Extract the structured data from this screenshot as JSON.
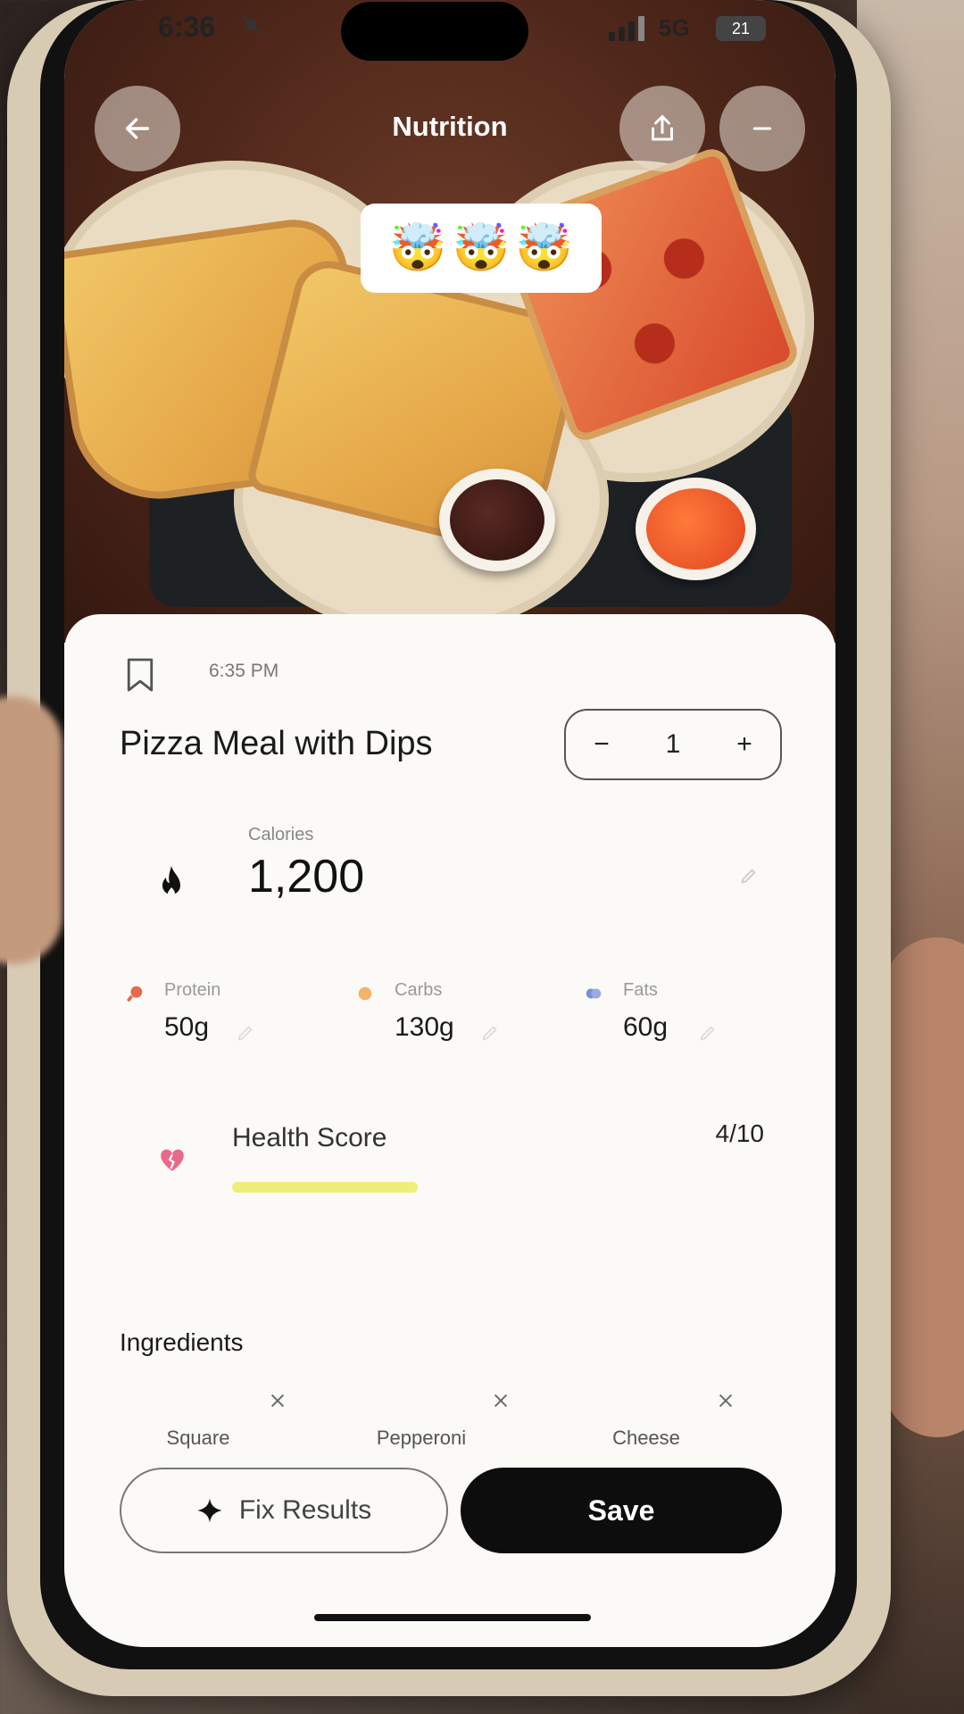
{
  "status_bar": {
    "time": "6:36",
    "network": "5G",
    "battery": "21"
  },
  "header": {
    "title": "Nutrition",
    "emoji": [
      "🤯",
      "🤯",
      "🤯"
    ]
  },
  "meal": {
    "time": "6:35 PM",
    "title": "Pizza Meal with Dips",
    "quantity": "1",
    "minus": "−",
    "plus": "+"
  },
  "calories": {
    "label": "Calories",
    "value": "1,200"
  },
  "macros": [
    {
      "label": "Protein",
      "value": "50g",
      "color": "#e8684c"
    },
    {
      "label": "Carbs",
      "value": "130g",
      "color": "#f2b46a"
    },
    {
      "label": "Fats",
      "value": "60g",
      "color": "#7a8fd6"
    }
  ],
  "health_score": {
    "label": "Health Score",
    "value": "4/10",
    "fraction": 0.4,
    "bar_color": "#f0ee7a"
  },
  "ingredients": {
    "title": "Ingredients",
    "items": [
      "Square",
      "Pepperoni",
      "Cheese"
    ]
  },
  "actions": {
    "fix_label": "Fix Results",
    "save_label": "Save"
  },
  "icons": {
    "back": "arrow-left-icon",
    "share": "share-icon",
    "more": "minus-icon",
    "bookmark": "bookmark-icon",
    "calories": "flame-icon",
    "health": "broken-heart-icon",
    "fix": "sparkle-icon"
  }
}
